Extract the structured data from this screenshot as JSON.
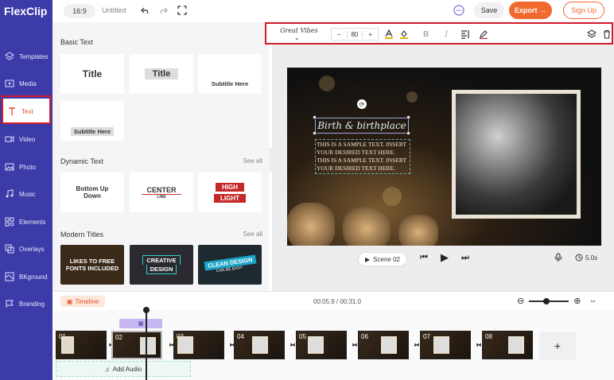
{
  "app": {
    "logo": "FlexClip",
    "untitled": "Untitled",
    "ratio": "16:9"
  },
  "top_actions": {
    "save": "Save",
    "export": "Export →",
    "signup": "Sign Up"
  },
  "nav": {
    "items": [
      {
        "label": "Templates",
        "icon": "layers-icon"
      },
      {
        "label": "Media",
        "icon": "media-icon"
      },
      {
        "label": "Text",
        "icon": "text-icon",
        "active": true
      },
      {
        "label": "Video",
        "icon": "video-icon"
      },
      {
        "label": "Photo",
        "icon": "photo-icon"
      },
      {
        "label": "Music",
        "icon": "music-icon"
      },
      {
        "label": "Elements",
        "icon": "elements-icon"
      },
      {
        "label": "Overlays",
        "icon": "overlays-icon"
      },
      {
        "label": "BKground",
        "icon": "background-icon"
      },
      {
        "label": "Branding",
        "icon": "branding-icon"
      }
    ]
  },
  "panel": {
    "basic_text_title": "Basic Text",
    "basic_cards": [
      "Title",
      "Title",
      "Subtitle Here",
      "Subtitle Here"
    ],
    "dynamic_text_title": "Dynamic Text",
    "dynamic_see_all": "See all",
    "dynamic_cards": [
      {
        "line1": "Bottom Up",
        "line2": "Down"
      },
      {
        "line1": "CENTER",
        "line2": "LINE"
      },
      {
        "line1": "HIGH",
        "line2": "LIGHT"
      }
    ],
    "modern_titles_title": "Modern Titles",
    "modern_see_all": "See all",
    "modern_cards": [
      {
        "line1": "LIKES TO FREE",
        "line2": "FONTS INCLUDED"
      },
      {
        "line1": "CREATIVE",
        "line2": "DESIGN"
      },
      {
        "line1": "CLEAN DESIGN",
        "line2": "CAN BE EASY"
      }
    ]
  },
  "text_toolbar": {
    "font": "Great Vibes",
    "size": "80",
    "minus": "−",
    "plus": "+"
  },
  "canvas": {
    "title_text": "Birth & birthplace",
    "body_text": "THIS IS A SAMPLE TEXT. INSERT YOUR DESIRED TEXT HERE. THIS IS A SAMPLE TEXT. INSERT YOUR DESIRED TEXT HERE."
  },
  "player": {
    "scene": "Scene 02",
    "duration": "5.0s"
  },
  "timeline": {
    "label": "Timeline",
    "time": "00:05.9 / 00:31.0",
    "clips": [
      "01",
      "02",
      "03",
      "04",
      "05",
      "06",
      "07",
      "08"
    ],
    "add_audio": "Add Audio",
    "add_clip": "+"
  },
  "colors": {
    "nav_bg": "#3c3ba8",
    "accent": "#f06a2f",
    "active_text": "#e0552b",
    "highlight": "#d11a2a"
  }
}
